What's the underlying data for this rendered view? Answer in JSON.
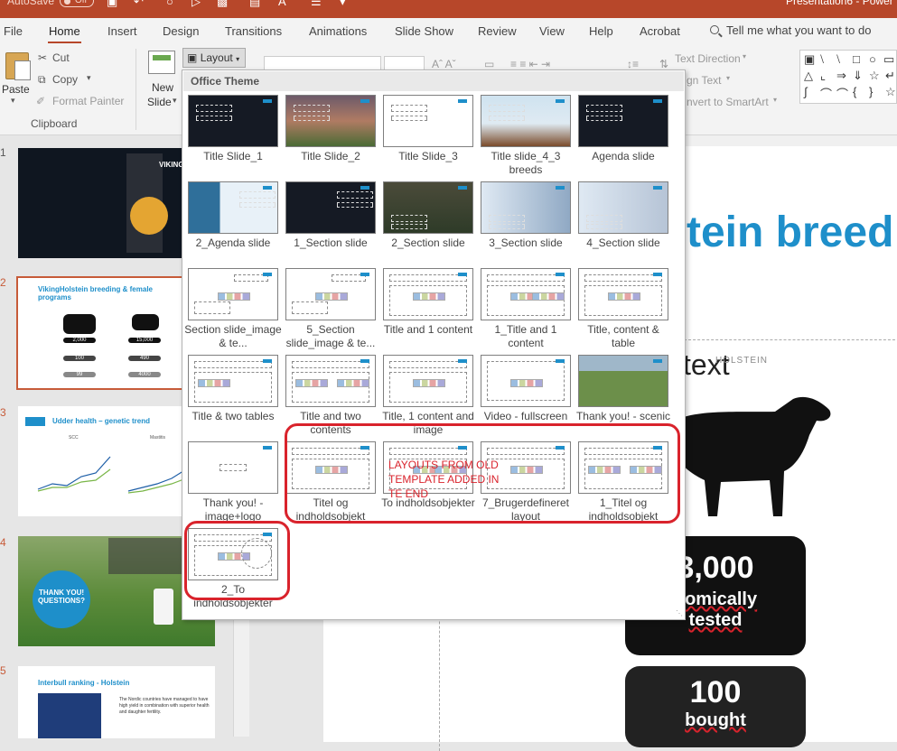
{
  "titlebar": {
    "autosave": "AutoSave",
    "autosave_state": "Off",
    "doc_title": "Presentation6 - Power"
  },
  "tabs": [
    "File",
    "Home",
    "Insert",
    "Design",
    "Transitions",
    "Animations",
    "Slide Show",
    "Review",
    "View",
    "Help",
    "Acrobat"
  ],
  "active_tab": "Home",
  "tell_me": "Tell me what you want to do",
  "ribbon": {
    "paste": "Paste",
    "cut": "Cut",
    "copy": "Copy",
    "format_painter": "Format Painter",
    "clipboard_group": "Clipboard",
    "new_slide": "New",
    "new_slide2": "Slide",
    "layout": "Layout",
    "text_direction": "Text Direction",
    "align_text": "gn Text",
    "convert_smartart": "nvert to SmartArt"
  },
  "dropdown": {
    "header": "Office Theme",
    "layouts": [
      {
        "label": "Title Slide_1"
      },
      {
        "label": "Title Slide_2"
      },
      {
        "label": "Title Slide_3"
      },
      {
        "label": "Title slide_4_3 breeds"
      },
      {
        "label": "Agenda slide"
      },
      {
        "label": "2_Agenda slide"
      },
      {
        "label": "1_Section slide"
      },
      {
        "label": "2_Section slide"
      },
      {
        "label": "3_Section slide"
      },
      {
        "label": "4_Section slide"
      },
      {
        "label": "Section slide_image & te..."
      },
      {
        "label": "5_Section slide_image & te..."
      },
      {
        "label": "Title and 1 content"
      },
      {
        "label": "1_Title and 1 content"
      },
      {
        "label": "Title, content & table"
      },
      {
        "label": "Title & two tables"
      },
      {
        "label": "Title and two contents"
      },
      {
        "label": "Title, 1 content and image"
      },
      {
        "label": "Video - fullscreen"
      },
      {
        "label": "Thank you! - scenic"
      },
      {
        "label": "Thank you! - image+logo"
      },
      {
        "label": "Titel og indholdsobjekt"
      },
      {
        "label": "To indholdsobjekter"
      },
      {
        "label": "7_Brugerdefineret layout"
      },
      {
        "label": "1_Titel og indholdsobjekt"
      },
      {
        "label": "2_To indholdsobjekter"
      }
    ],
    "annotation": "LAYOUTS FROM OLD TEMPLATE ADDED IN TE END"
  },
  "slides": [
    {
      "num": "1",
      "text": "VIKING"
    },
    {
      "num": "2",
      "title": "VikingHolstein breeding & female programs",
      "vals": [
        "2,000",
        "15,000",
        "100",
        "490",
        "99",
        "4000"
      ]
    },
    {
      "num": "3",
      "title": "Udder health – genetic trend",
      "sub": [
        "SCC",
        "Mastitis"
      ]
    },
    {
      "num": "4",
      "text": "THANK YOU! QUESTIONS?"
    },
    {
      "num": "5",
      "title": "Interbull ranking - Holstein",
      "body": "The Nordic countries have managed to have high yield in combination with superior health and daughter fertility."
    }
  ],
  "main_slide": {
    "title": "tein breed",
    "text": "text",
    "brand": "HOLSTEIN",
    "stat1_value": "3,000",
    "stat1_label1": "nomically",
    "stat1_label2": "tested",
    "stat2_value": "100",
    "stat2_label": "bought"
  },
  "colors": {
    "brand": "#b7472a",
    "accent_blue": "#1e8fca",
    "annotation_red": "#d9232c"
  }
}
